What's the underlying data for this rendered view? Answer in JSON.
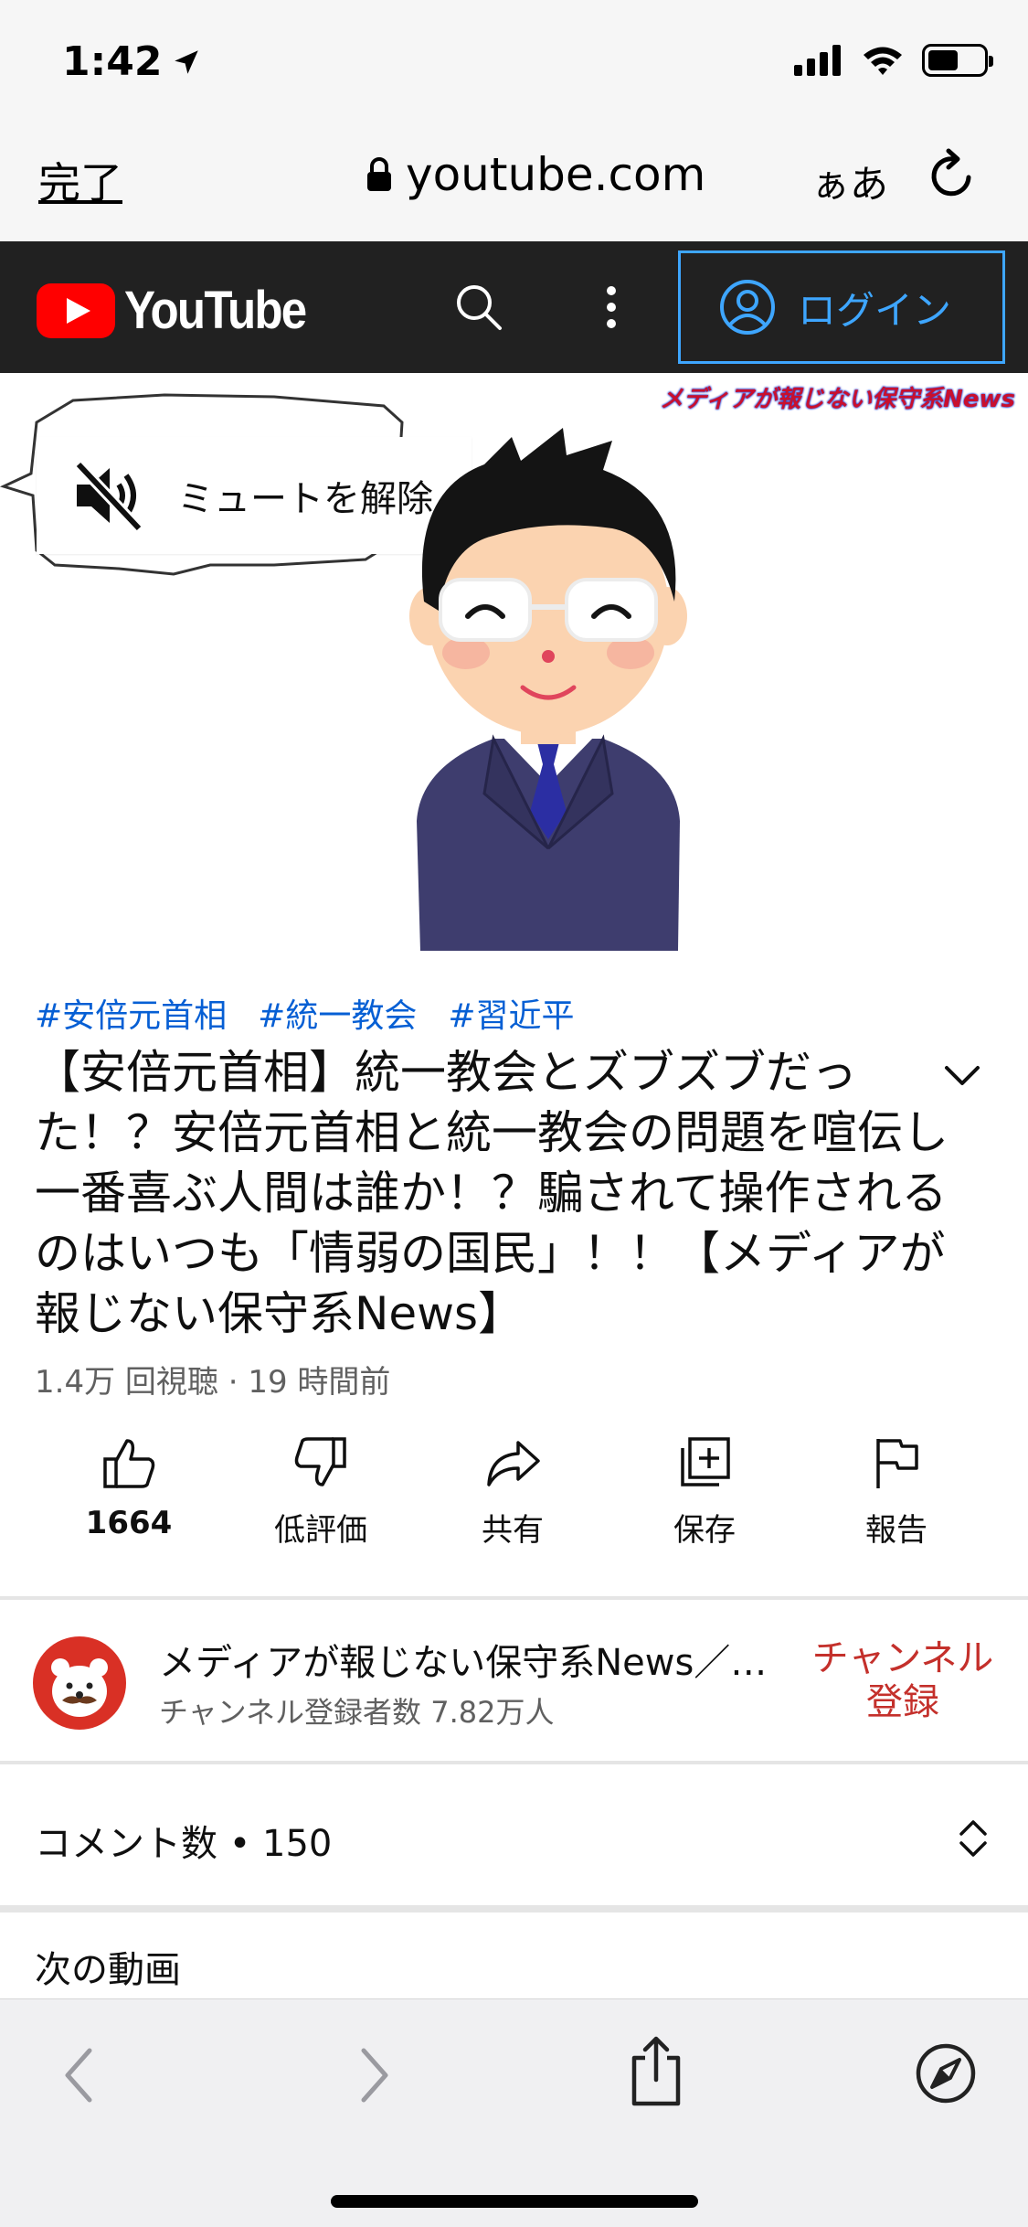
{
  "status": {
    "time": "1:42"
  },
  "browser": {
    "done_label": "完了",
    "url": "youtube.com",
    "text_size_label": "ぁあ"
  },
  "header": {
    "logo_text": "YouTube",
    "login_label": "ログイン",
    "accent_color": "#3ea6ff"
  },
  "video": {
    "channel_banner": "メディアが報じない保守系News",
    "mute_label": "ミュートを解除"
  },
  "hashtags": [
    "#安倍元首相",
    "#統一教会",
    "#習近平"
  ],
  "title": "【安倍元首相】統一教会とズブズブだった！？安倍元首相と統一教会の問題を喧伝し一番喜ぶ人間は誰か！？騙されて操作されるのはいつも「情弱の国民」！！【メディアが報じない保守系News】",
  "meta": {
    "views": "1.4万 回視聴",
    "separator": "·",
    "age": "19 時間前"
  },
  "actions": {
    "like": "1664",
    "dislike": "低評価",
    "share": "共有",
    "save": "保存",
    "report": "報告"
  },
  "channel": {
    "name": "メディアが報じない保守系News／…",
    "subscribers": "チャンネル登録者数 7.82万人",
    "subscribe_label": "チャンネル登録"
  },
  "comments": {
    "label": "コメント数 • 150"
  },
  "next": {
    "label": "次の動画"
  }
}
